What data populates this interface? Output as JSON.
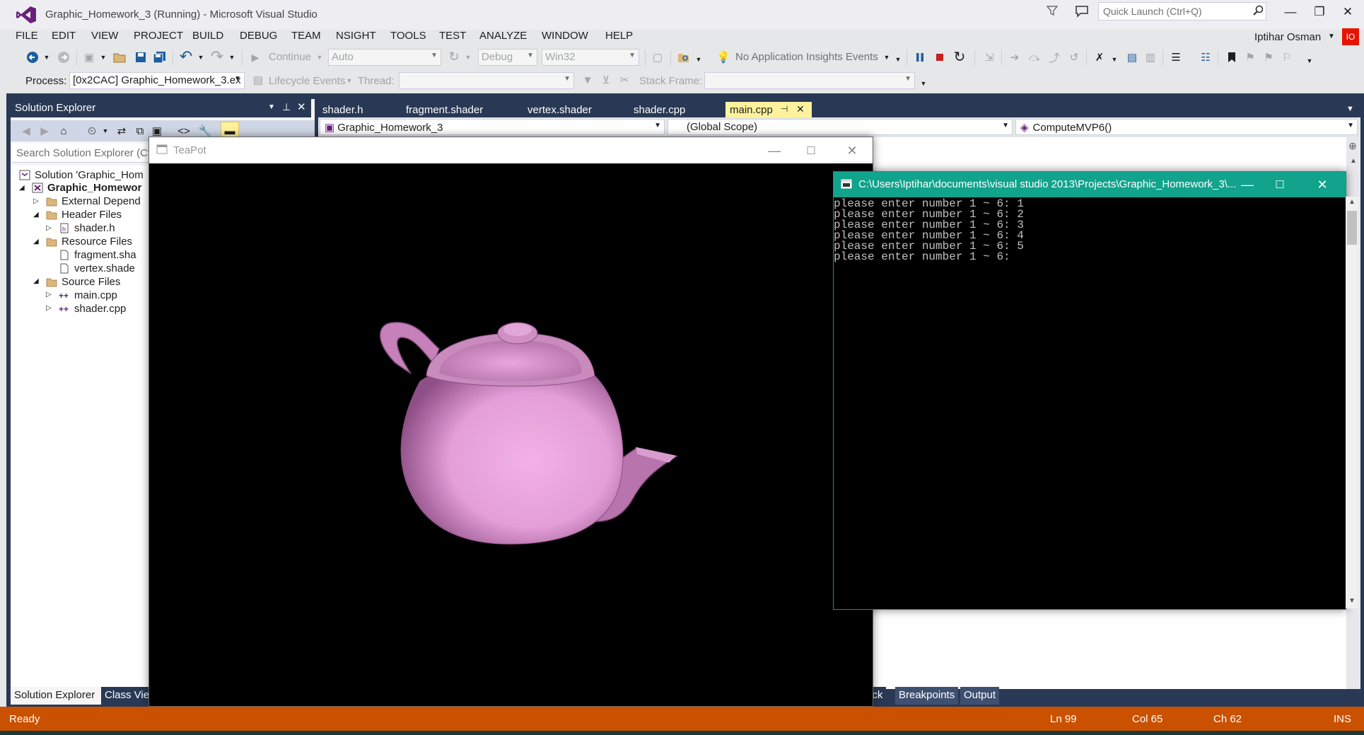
{
  "window": {
    "title": "Graphic_Homework_3 (Running) - Microsoft Visual Studio",
    "quick_launch_placeholder": "Quick Launch (Ctrl+Q)",
    "user_name": "Iptihar Osman",
    "user_badge": "IO",
    "buttons": {
      "minimize": "—",
      "maximize": "❐",
      "close": "✕"
    }
  },
  "menu": [
    "FILE",
    "EDIT",
    "VIEW",
    "PROJECT",
    "BUILD",
    "DEBUG",
    "TEAM",
    "NSIGHT",
    "TOOLS",
    "TEST",
    "ANALYZE",
    "WINDOW",
    "HELP"
  ],
  "toolbar": {
    "continue_label": "Continue",
    "solution_config": "Auto",
    "build_config": "Debug",
    "platform": "Win32",
    "insights": "No Application Insights Events"
  },
  "debug_location": {
    "process_label": "Process:",
    "process_value": "[0x2CAC] Graphic_Homework_3.ex",
    "lifecycle_label": "Lifecycle Events",
    "thread_label": "Thread:",
    "stack_frame_label": "Stack Frame:"
  },
  "solution_explorer": {
    "title": "Solution Explorer",
    "search_placeholder": "Search Solution Explorer (Ct",
    "tree": [
      {
        "label": "Solution 'Graphic_Hom",
        "depth": 0,
        "icon": "solution-icon",
        "arrow": "",
        "bold": false
      },
      {
        "label": "Graphic_Homewor",
        "depth": 0,
        "icon": "project-icon",
        "arrow": "◢",
        "bold": true
      },
      {
        "label": "External Depend",
        "depth": 1,
        "icon": "folder-icon",
        "arrow": "▷",
        "bold": false
      },
      {
        "label": "Header Files",
        "depth": 1,
        "icon": "folder-icon",
        "arrow": "◢",
        "bold": false
      },
      {
        "label": "shader.h",
        "depth": 2,
        "icon": "header-file-icon",
        "arrow": "▷",
        "bold": false
      },
      {
        "label": "Resource Files",
        "depth": 1,
        "icon": "folder-icon",
        "arrow": "◢",
        "bold": false
      },
      {
        "label": "fragment.sha",
        "depth": 2,
        "icon": "text-file-icon",
        "arrow": "",
        "bold": false
      },
      {
        "label": "vertex.shade",
        "depth": 2,
        "icon": "text-file-icon",
        "arrow": "",
        "bold": false
      },
      {
        "label": "Source Files",
        "depth": 1,
        "icon": "folder-icon",
        "arrow": "◢",
        "bold": false
      },
      {
        "label": "main.cpp",
        "depth": 2,
        "icon": "cpp-file-icon",
        "arrow": "▷",
        "bold": false
      },
      {
        "label": "shader.cpp",
        "depth": 2,
        "icon": "cpp-file-icon",
        "arrow": "▷",
        "bold": false
      }
    ],
    "bottom_tabs": [
      "Solution Explorer",
      "Class Vie"
    ]
  },
  "editor": {
    "tabs": [
      "shader.h",
      "fragment.shader",
      "vertex.shader",
      "shader.cpp",
      "main.cpp"
    ],
    "active_tab": "main.cpp",
    "nav_project": "Graphic_Homework_3",
    "nav_scope": "(Global Scope)",
    "nav_member": "ComputeMVP6()"
  },
  "bottom_tabs_right": [
    "ack",
    "Breakpoints",
    "Output"
  ],
  "teapot_window": {
    "title": "TeaPot",
    "teapot_color": "#e49ed8"
  },
  "console_window": {
    "title": "C:\\Users\\Iptihar\\documents\\visual studio 2013\\Projects\\Graphic_Homework_3\\...",
    "lines": [
      "please enter number 1 ~ 6: 1",
      "please enter number 1 ~ 6: 2",
      "please enter number 1 ~ 6: 3",
      "please enter number 1 ~ 6: 4",
      "please enter number 1 ~ 6: 5",
      "please enter number 1 ~ 6:"
    ]
  },
  "status_bar": {
    "state": "Ready",
    "line": "Ln 99",
    "col": "Col 65",
    "ch": "Ch 62",
    "mode": "INS"
  },
  "colors": {
    "status_bar": "#ca5100",
    "console_title": "#12a38c",
    "dock_background": "#293955",
    "active_tab": "#fff29d"
  }
}
